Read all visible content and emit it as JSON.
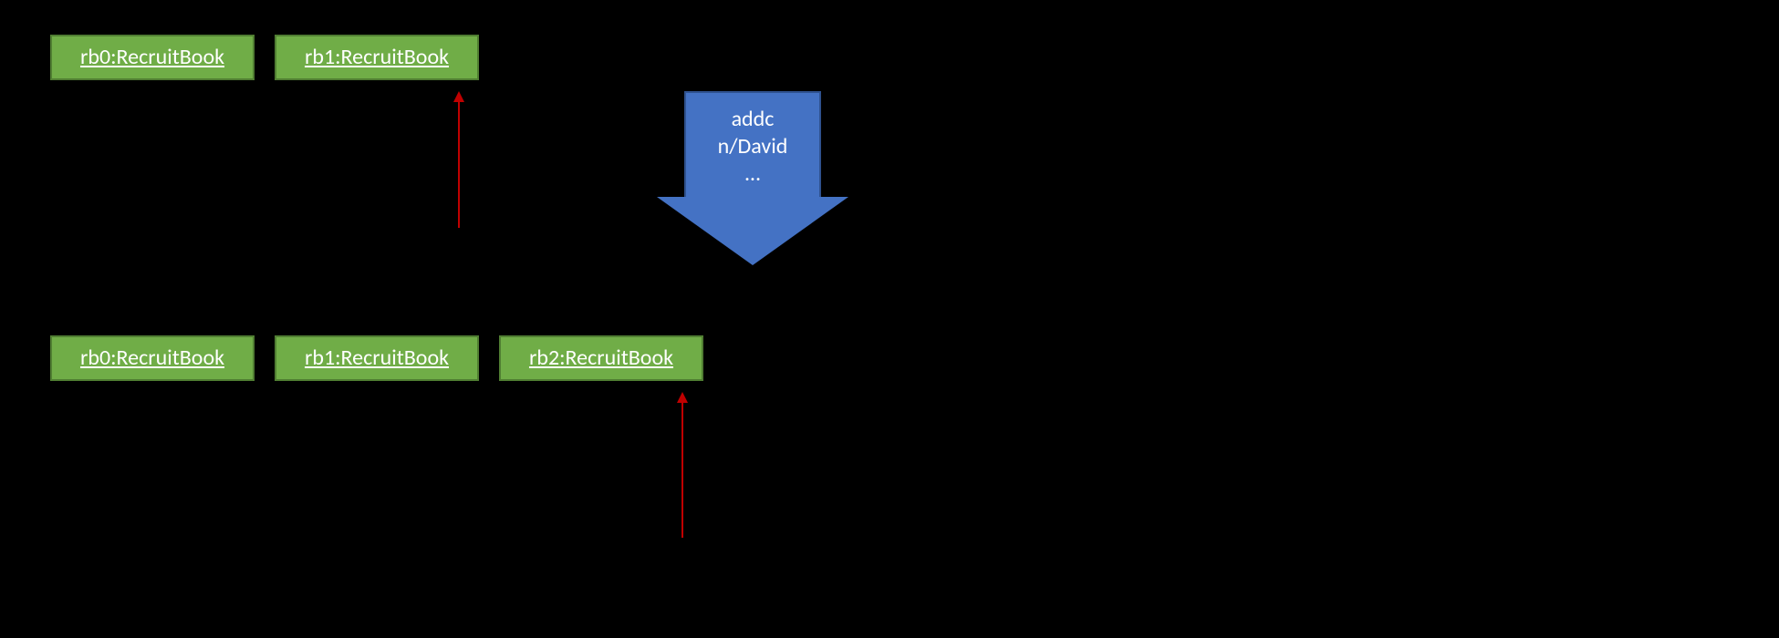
{
  "top_row": {
    "box0": "rb0:RecruitBook",
    "box1": "rb1:RecruitBook"
  },
  "bottom_row": {
    "box0": "rb0:RecruitBook",
    "box1": "rb1:RecruitBook",
    "box2": "rb2:RecruitBook"
  },
  "command_arrow": {
    "line1": "addc",
    "line2": "n/David",
    "line3": "…"
  }
}
